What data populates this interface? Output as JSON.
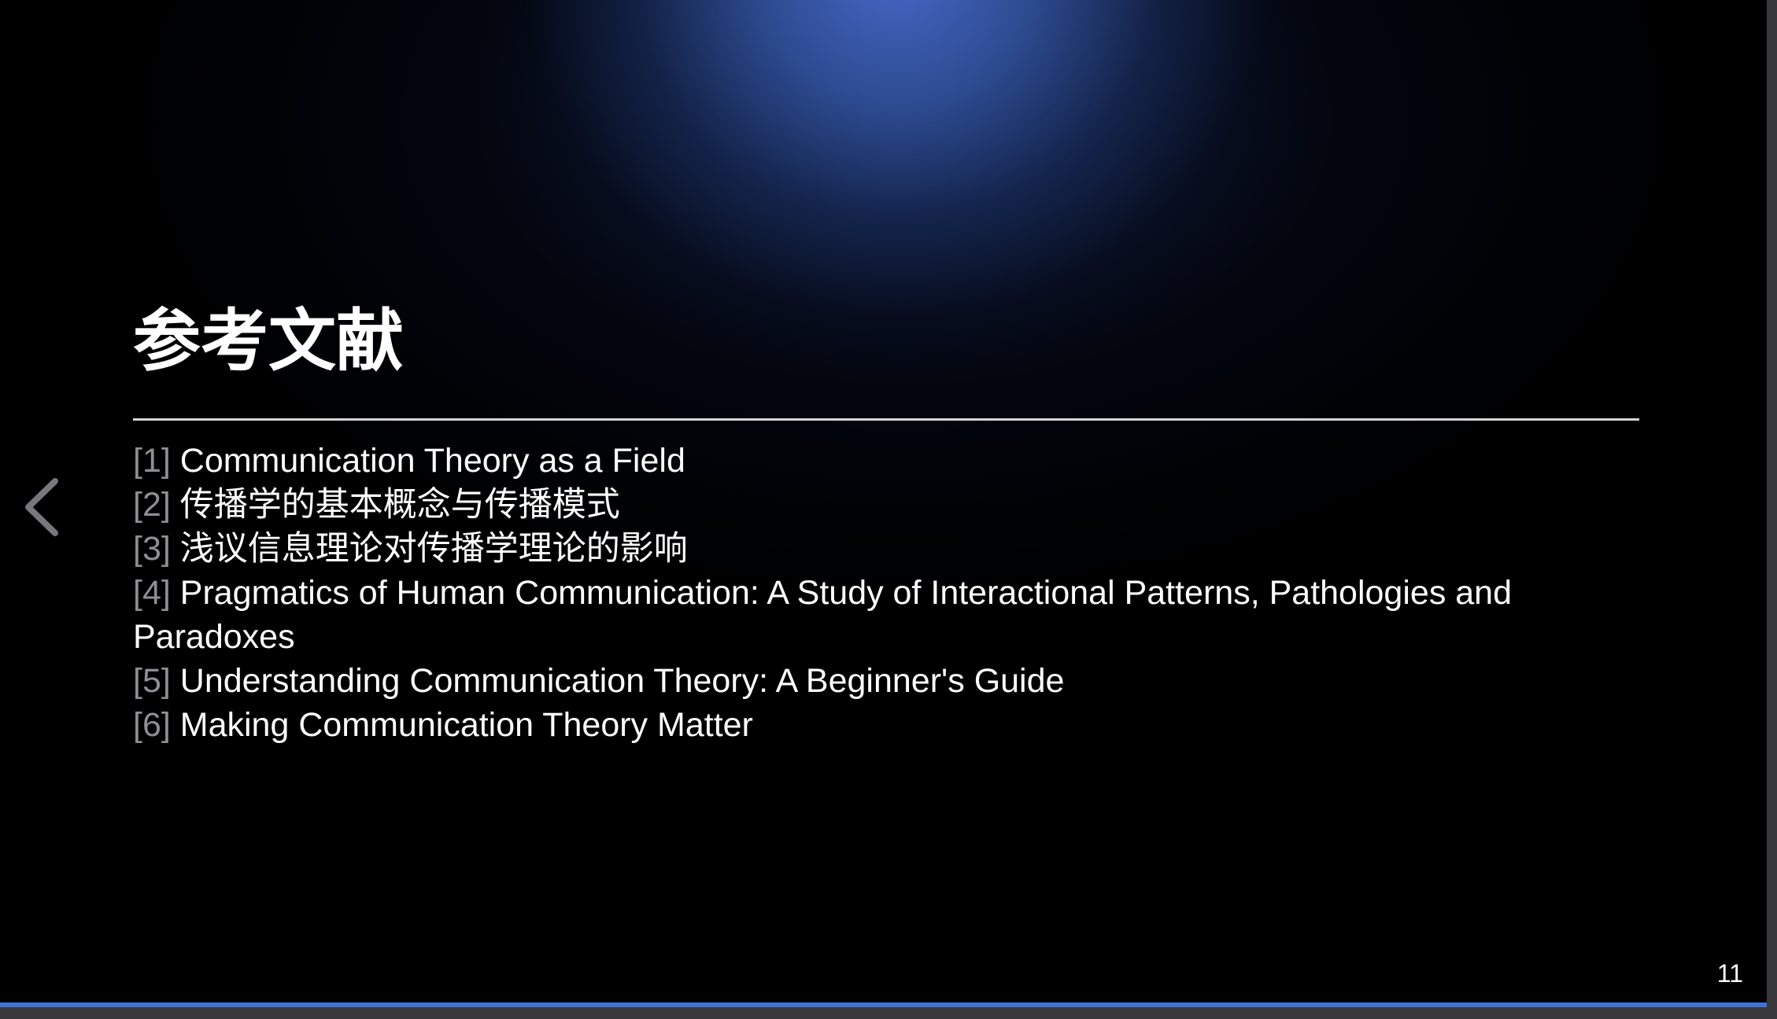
{
  "slide": {
    "title": "参考文献",
    "references": [
      {
        "num": "[1]",
        "text": "Communication Theory as a Field"
      },
      {
        "num": "[2]",
        "text": "传播学的基本概念与传播模式"
      },
      {
        "num": "[3]",
        "text": "浅议信息理论对传播学理论的影响"
      },
      {
        "num": "[4]",
        "text": "Pragmatics of Human Communication: A Study of Interactional Patterns, Pathologies and Paradoxes"
      },
      {
        "num": "[5]",
        "text": "Understanding Communication Theory: A Beginner's Guide"
      },
      {
        "num": "[6]",
        "text": "Making Communication Theory Matter"
      }
    ],
    "page_number": "11"
  },
  "navigation": {
    "prev_icon": "chevron-left-icon"
  },
  "progress": {
    "fraction": 1.0
  },
  "colors": {
    "accent": "#3d74d6",
    "text": "#ffffff",
    "ref_number": "#8e8e93",
    "rule": "#d4d4d6"
  }
}
